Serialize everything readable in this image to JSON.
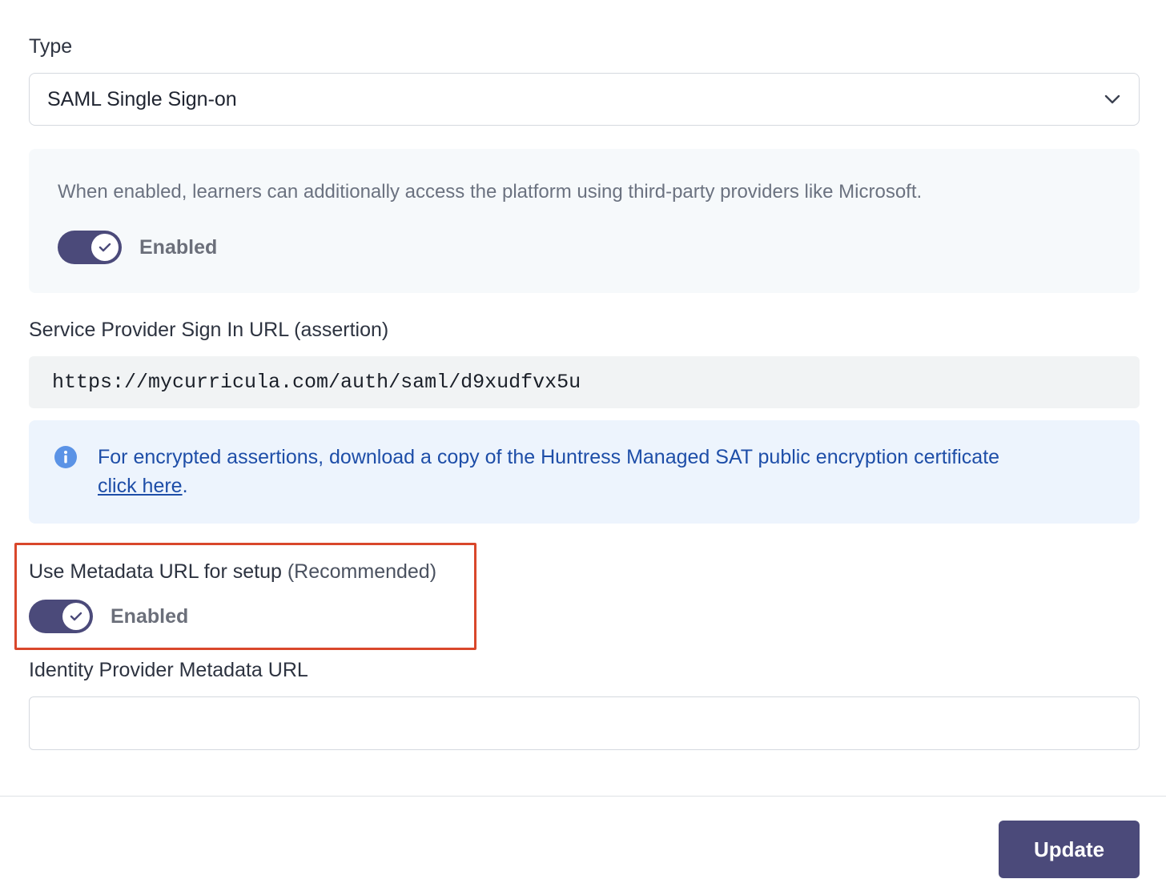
{
  "type_field": {
    "label": "Type",
    "selected": "SAML Single Sign-on"
  },
  "sso_panel": {
    "description": "When enabled, learners can additionally access the platform using third-party providers like Microsoft.",
    "toggle_state": "Enabled"
  },
  "sp_url": {
    "label": "Service Provider Sign In URL (assertion)",
    "value": "https://mycurricula.com/auth/saml/d9xudfvx5u"
  },
  "info_box": {
    "text": "For encrypted assertions, download a copy of the Huntress Managed SAT public encryption certificate",
    "link_text": "click here",
    "suffix": "."
  },
  "metadata_setup": {
    "label": "Use Metadata URL for setup",
    "label_note": "(Recommended)",
    "toggle_state": "Enabled"
  },
  "idp_metadata": {
    "label": "Identity Provider Metadata URL",
    "value": "",
    "placeholder": ""
  },
  "footer": {
    "update_label": "Update"
  },
  "colors": {
    "accent": "#4b4a7a",
    "info_text": "#1e4ea8",
    "info_bg": "#edf4fd",
    "highlight": "#d9472b"
  }
}
